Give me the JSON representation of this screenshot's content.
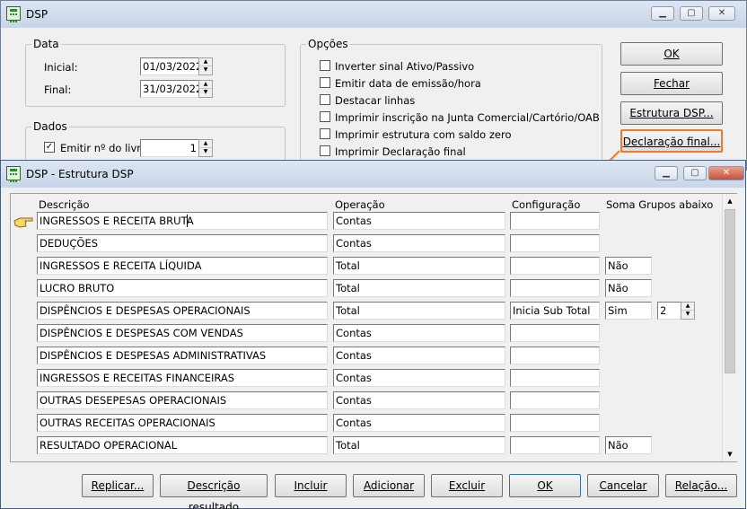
{
  "bg_window": {
    "title": "DSP",
    "data_group": {
      "title": "Data",
      "initial_label": "Inicial:",
      "initial_value": "01/03/2022",
      "final_label": "Final:",
      "final_value": "31/03/2022"
    },
    "dados_group": {
      "title": "Dados",
      "book_label": "Emitir nº do livro:",
      "book_value": "1"
    },
    "options_group": {
      "title": "Opções",
      "items": [
        "Inverter sinal Ativo/Passivo",
        "Emitir data de emissão/hora",
        "Destacar linhas",
        "Imprimir inscrição na Junta Comercial/Cartório/OAB",
        "Imprimir estrutura com saldo zero",
        "Imprimir Declaração final"
      ]
    },
    "buttons": {
      "ok": "OK",
      "fechar": "Fechar",
      "estrutura": "Estrutura DSP...",
      "declaracao": "Declaração final..."
    }
  },
  "fg_window": {
    "title": "DSP - Estrutura DSP",
    "columns": {
      "descricao": "Descrição",
      "operacao": "Operação",
      "configuracao": "Configuração",
      "soma": "Soma Grupos abaixo"
    },
    "rows": [
      {
        "descricao": "INGRESSOS E RECEITA BRUTA",
        "operacao": "Contas",
        "configuracao": "",
        "soma": "",
        "grupos": ""
      },
      {
        "descricao": "DEDUÇÕES",
        "operacao": "Contas",
        "configuracao": "",
        "soma": "",
        "grupos": ""
      },
      {
        "descricao": "INGRESSOS E RECEITA LÍQUIDA",
        "operacao": "Total",
        "configuracao": "",
        "soma": "Não",
        "grupos": ""
      },
      {
        "descricao": "LUCRO BRUTO",
        "operacao": "Total",
        "configuracao": "",
        "soma": "Não",
        "grupos": ""
      },
      {
        "descricao": "DISPÊNCIOS E DESPESAS OPERACIONAIS",
        "operacao": "Total",
        "configuracao": "Inicia Sub Total",
        "soma": "Sim",
        "grupos": "2"
      },
      {
        "descricao": "DISPÊNCIOS E DESPESAS COM VENDAS",
        "operacao": "Contas",
        "configuracao": "",
        "soma": "",
        "grupos": ""
      },
      {
        "descricao": "DISPÊNCIOS E DESPESAS ADMINISTRATIVAS",
        "operacao": "Contas",
        "configuracao": "",
        "soma": "",
        "grupos": ""
      },
      {
        "descricao": "INGRESSOS E RECEITAS FINANCEIRAS",
        "operacao": "Contas",
        "configuracao": "",
        "soma": "",
        "grupos": ""
      },
      {
        "descricao": "OUTRAS DESEPESAS OPERACIONAIS",
        "operacao": "Contas",
        "configuracao": "",
        "soma": "",
        "grupos": ""
      },
      {
        "descricao": "OUTRAS RECEITAS OPERACIONAIS",
        "operacao": "Contas",
        "configuracao": "",
        "soma": "",
        "grupos": ""
      },
      {
        "descricao": "RESULTADO OPERACIONAL",
        "operacao": "Total",
        "configuracao": "",
        "soma": "Não",
        "grupos": ""
      }
    ],
    "buttons": {
      "replicar": "Replicar...",
      "descricao_resultado": "Descrição resultado",
      "incluir": "Incluir",
      "adicionar": "Adicionar",
      "excluir": "Excluir",
      "ok": "OK",
      "cancelar": "Cancelar",
      "relacao": "Relação..."
    }
  },
  "colors": {
    "highlight": "#f07a2a",
    "titlebar": "#c7d5e8"
  }
}
